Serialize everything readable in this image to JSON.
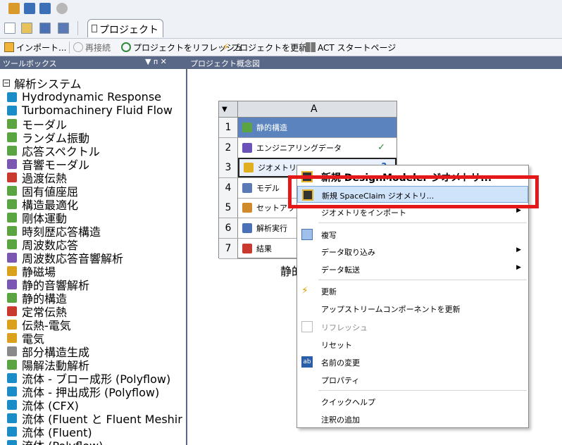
{
  "toolbar": {
    "tab_label": "プロジェクト",
    "import_label": "インポート...",
    "reconnect_label": "再接続",
    "refresh_label": "プロジェクトをリフレッシュ",
    "update_label": "プロジェクトを更新",
    "act_label": "ACT スタートページ"
  },
  "toolbox": {
    "title": "ツールボックス",
    "pin_glyph": "▼ ᴨ ✕",
    "category": "解析システム",
    "items": [
      {
        "label": "Hydrodynamic Response",
        "color": "#1a8cc7"
      },
      {
        "label": "Turbomachinery Fluid Flow",
        "color": "#1a8cc7"
      },
      {
        "label": "モーダル",
        "color": "#5aa542"
      },
      {
        "label": "ランダム振動",
        "color": "#5aa542"
      },
      {
        "label": "応答スペクトル",
        "color": "#5aa542"
      },
      {
        "label": "音響モーダル",
        "color": "#7a57b0"
      },
      {
        "label": "過渡伝熱",
        "color": "#c9392d"
      },
      {
        "label": "固有値座屈",
        "color": "#5aa542"
      },
      {
        "label": "構造最適化",
        "color": "#5aa542"
      },
      {
        "label": "剛体運動",
        "color": "#5aa542"
      },
      {
        "label": "時刻歴応答構造",
        "color": "#5aa542"
      },
      {
        "label": "周波数応答",
        "color": "#5aa542"
      },
      {
        "label": "周波数応答音響解析",
        "color": "#7a57b0"
      },
      {
        "label": "静磁場",
        "color": "#d9a11c"
      },
      {
        "label": "静的音響解析",
        "color": "#7a57b0"
      },
      {
        "label": "静的構造",
        "color": "#5aa542"
      },
      {
        "label": "定常伝熱",
        "color": "#c9392d"
      },
      {
        "label": "伝熱-電気",
        "color": "#d9a11c"
      },
      {
        "label": "電気",
        "color": "#d9a11c"
      },
      {
        "label": "部分構造生成",
        "color": "#8a8a8a"
      },
      {
        "label": "陽解法動解析",
        "color": "#5aa542"
      },
      {
        "label": "流体 - ブロー成形 (Polyflow)",
        "color": "#1a8cc7"
      },
      {
        "label": "流体 - 押出成形 (Polyflow)",
        "color": "#1a8cc7"
      },
      {
        "label": "流体 (CFX)",
        "color": "#1a8cc7"
      },
      {
        "label": "流体 (Fluent と Fluent Meshir",
        "color": "#1a8cc7"
      },
      {
        "label": "流体 (Fluent)",
        "color": "#1a8cc7"
      },
      {
        "label": "流体 (Polyflow)",
        "color": "#1a8cc7"
      }
    ]
  },
  "schematic": {
    "title": "プロジェクト概念図",
    "column": "A",
    "system_label": "静的構造",
    "rows": [
      {
        "num": "1",
        "label": "静的構造"
      },
      {
        "num": "2",
        "label": "エンジニアリングデータ",
        "status": "✓"
      },
      {
        "num": "3",
        "label": "ジオメトリ",
        "status": "?"
      },
      {
        "num": "4",
        "label": "モデル"
      },
      {
        "num": "5",
        "label": "セットアップ"
      },
      {
        "num": "6",
        "label": "解析実行"
      },
      {
        "num": "7",
        "label": "結果"
      }
    ]
  },
  "context_menu": {
    "new_dm": "新規 DesignModeler ジオメトリ...",
    "new_sc": "新規 SpaceClaim ジオメトリ...",
    "import_geom": "ジオメトリをインポート",
    "duplicate": "複写",
    "data_import": "データ取り込み",
    "data_transfer": "データ転送",
    "update": "更新",
    "update_upstream": "アップストリームコンポーネントを更新",
    "refresh": "リフレッシュ",
    "reset": "リセット",
    "rename": "名前の変更",
    "properties": "プロパティ",
    "quick_help": "クイックヘルプ",
    "add_note": "注釈の追加"
  }
}
